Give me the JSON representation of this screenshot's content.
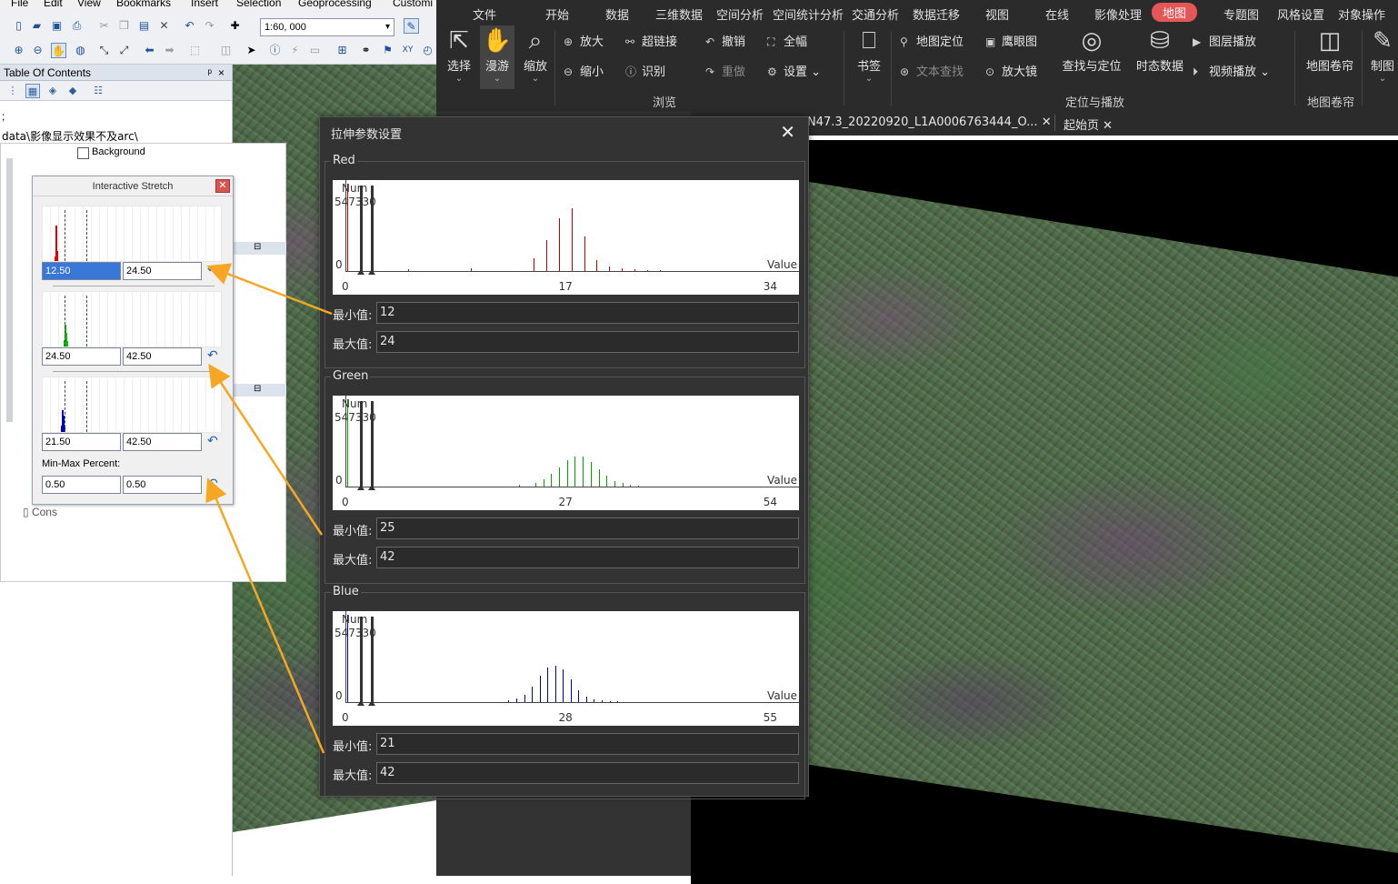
{
  "arcmap": {
    "menu": [
      "File",
      "Edit",
      "View",
      "Bookmarks",
      "Insert",
      "Selection",
      "Geoprocessing",
      "Customi"
    ],
    "scale": "1:60, 000",
    "toc_title": "Table Of Contents",
    "toc_pin": "ᵖ",
    "toc_close": "×",
    "path_text": "data\\影像显示效果不及arc\\",
    "background_label": "Background",
    "cons_label": "Cons"
  },
  "interactive_stretch": {
    "title": "Interactive Stretch",
    "red": {
      "min": "12.50",
      "max": "24.50"
    },
    "green": {
      "min": "24.50",
      "max": "42.50"
    },
    "blue": {
      "min": "21.50",
      "max": "42.50"
    },
    "minmax_label": "Min-Max Percent:",
    "percent": {
      "min": "0.50",
      "max": "0.50"
    }
  },
  "ribbon": {
    "tabs": [
      "文件",
      "开始",
      "数据",
      "三维数据",
      "空间分析",
      "空间统计分析",
      "交通分析",
      "数据迁移",
      "视图",
      "在线",
      "影像处理",
      "地图",
      "专题图",
      "风格设置",
      "对象操作"
    ],
    "active_tab": "地图",
    "tools": {
      "select": "选择",
      "pan": "漫游",
      "zoom": "缩放",
      "zoom_in": "放大",
      "zoom_out": "缩小",
      "hyperlink": "超链接",
      "identify": "识别",
      "undo": "撤销",
      "redo": "重做",
      "full_extent": "全幅",
      "settings": "设置",
      "bookmark": "书签",
      "map_locate": "地图定位",
      "text_search": "文本查找",
      "eagle_eye": "鹰眼图",
      "magnifier": "放大镜",
      "find_locate": "查找与定位",
      "temporal": "时态数据",
      "layer_play": "图层播放",
      "video_play": "视频播放",
      "swipe": "地图卷帘",
      "make": "制图"
    },
    "groups": {
      "browse": "浏览",
      "locate_play": "定位与播放",
      "swipe": "地图卷帘"
    }
  },
  "doc_tabs": [
    {
      "label": "N47.3_20220920_L1A0006763444_O..."
    },
    {
      "label": "起始页"
    }
  ],
  "stretch_dialog": {
    "title": "拉伸参数设置",
    "min_label": "最小值:",
    "max_label": "最大值:",
    "num_label": "Num",
    "value_label": "Value",
    "bands": [
      {
        "name": "Red",
        "color": "#c00000",
        "ymax": "547330",
        "xmin": "0",
        "xmid": "17",
        "xmax": "34",
        "min": "12",
        "max": "24",
        "bins": [
          [
            5,
            0.02
          ],
          [
            10,
            0.03
          ],
          [
            15,
            0.15
          ],
          [
            16,
            0.35
          ],
          [
            17,
            0.6
          ],
          [
            18,
            0.72
          ],
          [
            19,
            0.4
          ],
          [
            20,
            0.12
          ],
          [
            21,
            0.05
          ],
          [
            22,
            0.03
          ],
          [
            23,
            0.02
          ],
          [
            24,
            0.01
          ],
          [
            25,
            0.01
          ]
        ]
      },
      {
        "name": "Green",
        "color": "#00a800",
        "ymax": "547330",
        "xmin": "0",
        "xmid": "27",
        "xmax": "54",
        "min": "25",
        "max": "42",
        "bins": [
          [
            22,
            0.02
          ],
          [
            24,
            0.04
          ],
          [
            25,
            0.08
          ],
          [
            26,
            0.15
          ],
          [
            27,
            0.22
          ],
          [
            28,
            0.3
          ],
          [
            29,
            0.34
          ],
          [
            30,
            0.34
          ],
          [
            31,
            0.28
          ],
          [
            32,
            0.2
          ],
          [
            33,
            0.12
          ],
          [
            34,
            0.06
          ],
          [
            35,
            0.04
          ],
          [
            36,
            0.02
          ],
          [
            37,
            0.01
          ]
        ]
      },
      {
        "name": "Blue",
        "color": "#0000b0",
        "ymax": "547330",
        "xmin": "0",
        "xmid": "28",
        "xmax": "55",
        "min": "21",
        "max": "42",
        "bins": [
          [
            21,
            0.02
          ],
          [
            22,
            0.04
          ],
          [
            23,
            0.08
          ],
          [
            24,
            0.18
          ],
          [
            25,
            0.3
          ],
          [
            26,
            0.4
          ],
          [
            27,
            0.42
          ],
          [
            28,
            0.38
          ],
          [
            29,
            0.26
          ],
          [
            30,
            0.14
          ],
          [
            31,
            0.06
          ],
          [
            32,
            0.03
          ],
          [
            33,
            0.02
          ],
          [
            34,
            0.01
          ],
          [
            35,
            0.01
          ]
        ]
      }
    ]
  },
  "colors": {
    "active_tab": "#e55656",
    "ribbon_bg": "#2b2b2b",
    "arrow": "#f5a623"
  }
}
